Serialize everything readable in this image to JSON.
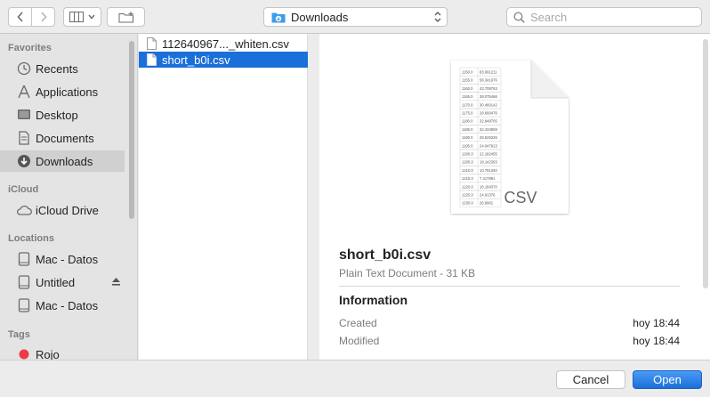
{
  "toolbar": {
    "location": "Downloads",
    "search_placeholder": "Search"
  },
  "sidebar": {
    "sections": {
      "favorites": "Favorites",
      "icloud": "iCloud",
      "locations": "Locations",
      "tags": "Tags"
    },
    "favorites": [
      {
        "label": "Recents",
        "icon": "clock-icon"
      },
      {
        "label": "Applications",
        "icon": "applications-icon"
      },
      {
        "label": "Desktop",
        "icon": "desktop-icon"
      },
      {
        "label": "Documents",
        "icon": "document-icon"
      },
      {
        "label": "Downloads",
        "icon": "download-icon",
        "selected": true
      }
    ],
    "icloud": [
      {
        "label": "iCloud Drive",
        "icon": "cloud-icon"
      }
    ],
    "locations": [
      {
        "label": "Mac - Datos",
        "icon": "drive-icon"
      },
      {
        "label": "Untitled",
        "icon": "drive-icon",
        "eject": true
      },
      {
        "label": "Mac - Datos",
        "icon": "drive-icon"
      }
    ],
    "tags": [
      {
        "label": "Rojo",
        "color": "#ec3b46"
      }
    ]
  },
  "files": [
    {
      "name": "112640967..._whiten.csv",
      "selected": false
    },
    {
      "name": "short_b0i.csv",
      "selected": true
    }
  ],
  "preview": {
    "thumb_label": "CSV",
    "thumb_rows": [
      [
        "1150.0",
        "83.991211"
      ],
      [
        "1155.0",
        "58.341976"
      ],
      [
        "1160.0",
        "43.708763"
      ],
      [
        "1165.0",
        "39.075466"
      ],
      [
        "1170.0",
        "30.460142"
      ],
      [
        "1175.0",
        "28.660476"
      ],
      [
        "1180.0",
        "32.948705"
      ],
      [
        "1185.0",
        "32.434659"
      ],
      [
        "1190.0",
        "28.525326"
      ],
      [
        "1195.0",
        "24.047913"
      ],
      [
        "1200.0",
        "22.182455"
      ],
      [
        "1205.0",
        "18.142393"
      ],
      [
        "1210.0",
        "10.791340"
      ],
      [
        "1215.0",
        "7.417881"
      ],
      [
        "1220.0",
        "16.184370"
      ],
      [
        "1225.0",
        "24.91376"
      ],
      [
        "1230.0",
        "26.9901"
      ]
    ],
    "file_name": "short_b0i.csv",
    "kind": "Plain Text Document - 31 KB",
    "info_heading": "Information",
    "created_label": "Created",
    "created_value": "hoy 18:44",
    "modified_label": "Modified",
    "modified_value": "hoy 18:44"
  },
  "buttons": {
    "cancel": "Cancel",
    "open": "Open"
  },
  "colors": {
    "accent": "#1b6fd9",
    "tag_red": "#ec3b46"
  }
}
